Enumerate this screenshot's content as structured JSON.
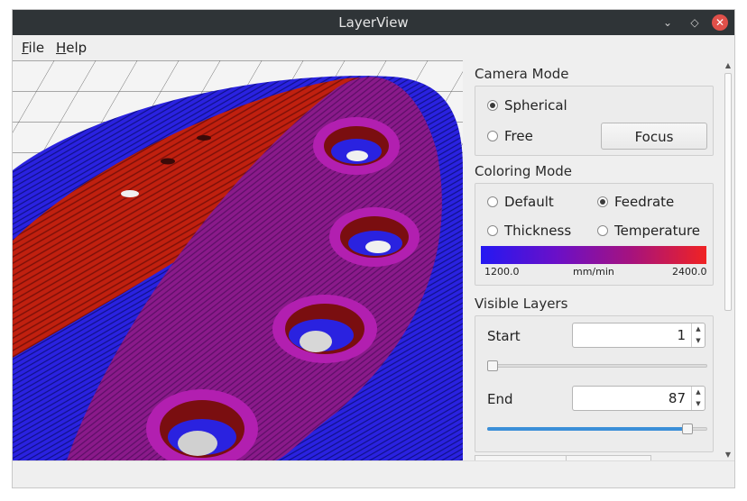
{
  "window": {
    "title": "LayerView"
  },
  "window_controls": {
    "minimize_icon": "minimize-icon",
    "maximize_icon": "maximize-icon",
    "close_icon": "close-icon"
  },
  "menu": {
    "file": {
      "mnemonic": "F",
      "rest": "ile"
    },
    "help": {
      "mnemonic": "H",
      "rest": "elp"
    }
  },
  "camera_mode": {
    "label": "Camera Mode",
    "options": [
      {
        "label": "Spherical",
        "checked": true
      },
      {
        "label": "Free",
        "checked": false
      }
    ],
    "focus_button": "Focus"
  },
  "coloring_mode": {
    "label": "Coloring Mode",
    "options": [
      {
        "label": "Default",
        "checked": false
      },
      {
        "label": "Feedrate",
        "checked": true
      },
      {
        "label": "Thickness",
        "checked": false
      },
      {
        "label": "Temperature",
        "checked": false
      }
    ],
    "legend": {
      "min": "1200.0",
      "unit": "mm/min",
      "max": "2400.0"
    },
    "gradient_colors": [
      "#2418f2",
      "#6a10c8",
      "#a6127e",
      "#f02323"
    ]
  },
  "visible_layers": {
    "label": "Visible Layers",
    "start": {
      "label": "Start",
      "value": "1",
      "slider_fraction": 0.0
    },
    "end": {
      "label": "End",
      "value": "87",
      "slider_fraction": 0.93
    }
  },
  "colors": {
    "titlebar": "#2f3437",
    "accent": "#3b8fd8",
    "close": "#e0504a"
  }
}
